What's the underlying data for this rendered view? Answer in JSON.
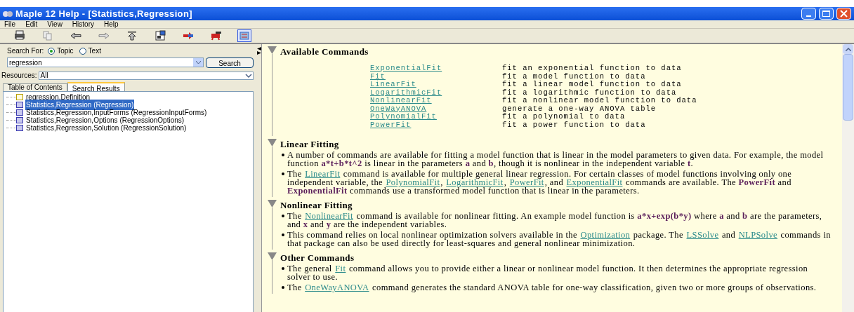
{
  "window": {
    "title": "Maple 12 Help - [Statistics,Regression]"
  },
  "menu": [
    "File",
    "Edit",
    "View",
    "History",
    "Help"
  ],
  "toolbar": [
    {
      "kind": "print"
    },
    {
      "kind": "copy"
    },
    {
      "kind": "back"
    },
    {
      "kind": "forward"
    },
    {
      "kind": "up"
    },
    {
      "kind": "dictionary"
    },
    {
      "kind": "add"
    },
    {
      "kind": "remove"
    },
    {
      "kind": "sync",
      "selected": true
    }
  ],
  "search": {
    "label": "Search For:",
    "options": [
      {
        "label": "Topic",
        "selected": true
      },
      {
        "label": "Text",
        "selected": false
      }
    ],
    "value": "regression",
    "button": "Search"
  },
  "resources": {
    "label": "Resources:",
    "value": "All"
  },
  "tabs": [
    {
      "label": "Table of Contents",
      "selected": false
    },
    {
      "label": "Search Results",
      "selected": true
    }
  ],
  "results": [
    {
      "kind": "definition",
      "label": "regression,Definition",
      "selected": false
    },
    {
      "kind": "help",
      "label": "Statistics,Regression (Regression)",
      "selected": true
    },
    {
      "kind": "help",
      "label": "Statistics,Regression,InputForms (RegressionInputForms)",
      "selected": false
    },
    {
      "kind": "help",
      "label": "Statistics,Regression,Options (RegressionOptions)",
      "selected": false
    },
    {
      "kind": "help",
      "label": "Statistics,Regression,Solution (RegressionSolution)",
      "selected": false
    }
  ],
  "sections": [
    {
      "title": "Available Commands",
      "kind": "table",
      "rows": [
        {
          "command": "ExponentialFit",
          "description": "fit an exponential function to data"
        },
        {
          "command": "Fit",
          "description": "fit a model function to data"
        },
        {
          "command": "LinearFit",
          "description": "fit a linear model function to data"
        },
        {
          "command": "LogarithmicFit",
          "description": "fit a logarithmic function to data"
        },
        {
          "command": "NonlinearFit",
          "description": "fit a nonlinear model function to data"
        },
        {
          "command": "OneWayANOVA",
          "description": "generate a one-way ANOVA table"
        },
        {
          "command": "PolynomialFit",
          "description": "fit a polynomial to data"
        },
        {
          "command": "PowerFit",
          "description": "fit a power function to data"
        }
      ]
    },
    {
      "title": "Linear Fitting",
      "kind": "bullets",
      "items": [
        [
          {
            "kind": "text",
            "text": "A number of commands are available for fitting a model function that is linear in the model parameters to given data. For example, the model function "
          },
          {
            "kind": "code",
            "text": "a*t+b*t^2"
          },
          {
            "kind": "text",
            "text": " is linear in the parameters "
          },
          {
            "kind": "code",
            "text": "a"
          },
          {
            "kind": "text",
            "text": " and "
          },
          {
            "kind": "code",
            "text": "b"
          },
          {
            "kind": "text",
            "text": ", though it is nonlinear in the independent variable "
          },
          {
            "kind": "code",
            "text": "t"
          },
          {
            "kind": "text",
            "text": "."
          }
        ],
        [
          {
            "kind": "text",
            "text": "The "
          },
          {
            "kind": "link",
            "text": "LinearFit"
          },
          {
            "kind": "text",
            "text": " command is available for multiple general linear regression. For certain classes of model functions involving only one independent variable, the "
          },
          {
            "kind": "link",
            "text": "PolynomialFit"
          },
          {
            "kind": "text",
            "text": ", "
          },
          {
            "kind": "link",
            "text": "LogarithmicFit"
          },
          {
            "kind": "text",
            "text": ", "
          },
          {
            "kind": "link",
            "text": "PowerFit"
          },
          {
            "kind": "text",
            "text": ", and "
          },
          {
            "kind": "link",
            "text": "ExponentialFit"
          },
          {
            "kind": "text",
            "text": " commands are available. The "
          },
          {
            "kind": "code",
            "text": "PowerFit"
          },
          {
            "kind": "text",
            "text": " and "
          },
          {
            "kind": "code",
            "text": "ExponentialFit"
          },
          {
            "kind": "text",
            "text": " commands use a transformed model function that is linear in the parameters."
          }
        ]
      ]
    },
    {
      "title": "Nonlinear Fitting",
      "kind": "bullets",
      "items": [
        [
          {
            "kind": "text",
            "text": "The "
          },
          {
            "kind": "link",
            "text": "NonlinearFit"
          },
          {
            "kind": "text",
            "text": " command is available for nonlinear fitting. An example model function is "
          },
          {
            "kind": "code",
            "text": "a*x+exp(b*y)"
          },
          {
            "kind": "text",
            "text": " where "
          },
          {
            "kind": "code",
            "text": "a"
          },
          {
            "kind": "text",
            "text": " and "
          },
          {
            "kind": "code",
            "text": "b"
          },
          {
            "kind": "text",
            "text": " are the parameters, and "
          },
          {
            "kind": "code",
            "text": "x"
          },
          {
            "kind": "text",
            "text": " and "
          },
          {
            "kind": "code",
            "text": "y"
          },
          {
            "kind": "text",
            "text": " are the independent variables."
          }
        ],
        [
          {
            "kind": "text",
            "text": "This command relies on local nonlinear optimization solvers available in the "
          },
          {
            "kind": "link",
            "text": "Optimization"
          },
          {
            "kind": "text",
            "text": " package. The "
          },
          {
            "kind": "link",
            "text": "LSSolve"
          },
          {
            "kind": "text",
            "text": " and "
          },
          {
            "kind": "link",
            "text": "NLPSolve"
          },
          {
            "kind": "text",
            "text": " commands in that package can also be used directly for least-squares and general nonlinear minimization."
          }
        ]
      ]
    },
    {
      "title": "Other Commands",
      "kind": "bullets",
      "items": [
        [
          {
            "kind": "text",
            "text": "The general "
          },
          {
            "kind": "link",
            "text": "Fit"
          },
          {
            "kind": "text",
            "text": " command allows you to provide either a linear or nonlinear model function. It then determines the appropriate regression solver to use."
          }
        ],
        [
          {
            "kind": "text",
            "text": "The "
          },
          {
            "kind": "link",
            "text": "OneWayANOVA"
          },
          {
            "kind": "text",
            "text": " command generates the standard ANOVA table for one-way classification, given two or more groups of observations."
          }
        ]
      ]
    }
  ]
}
